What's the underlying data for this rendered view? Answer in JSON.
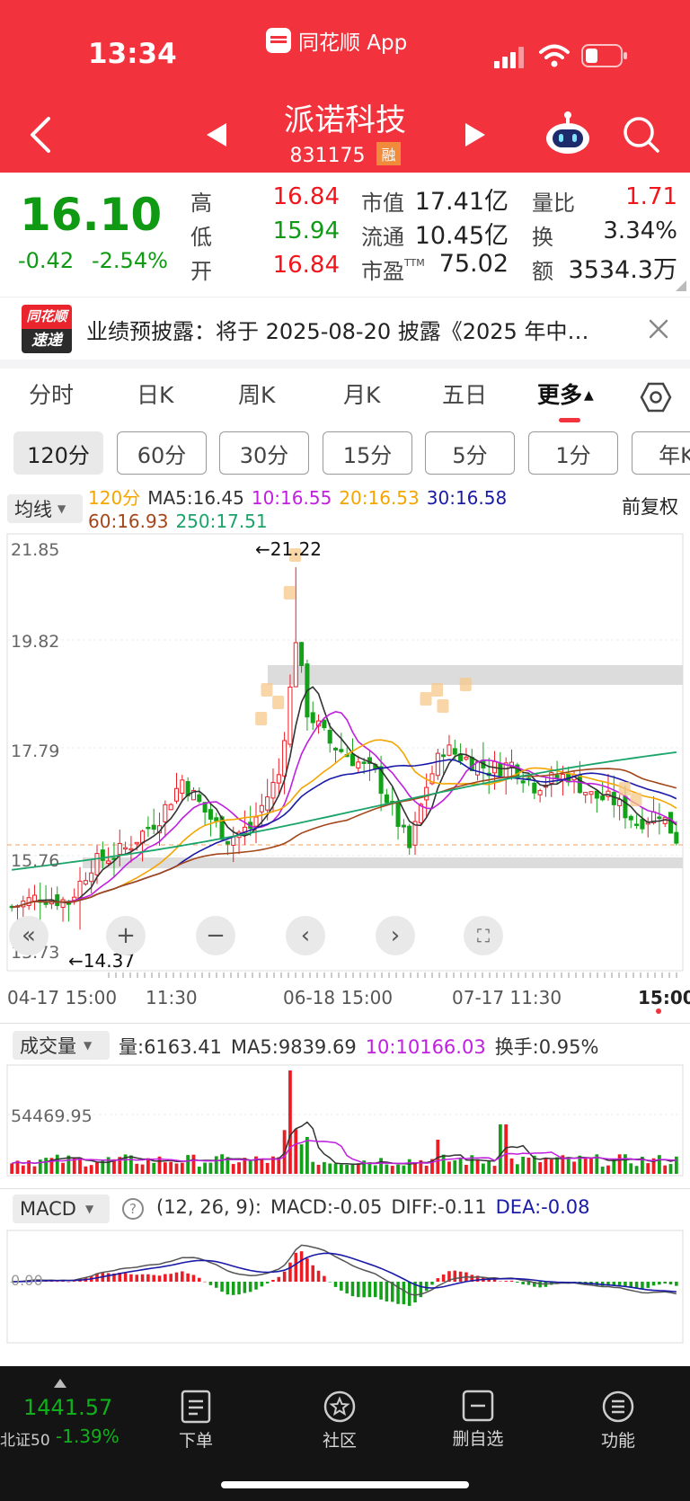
{
  "status_bar": {
    "time": "13:34",
    "app_label": "同花顺 App"
  },
  "nav": {
    "stock_name": "派诺科技",
    "stock_code": "831175",
    "badge": "融"
  },
  "quote": {
    "price": "16.10",
    "change": "-0.42",
    "change_pct": "-2.54%",
    "stats": [
      {
        "label": "高",
        "value": "16.84"
      },
      {
        "label": "低",
        "value": "15.94"
      },
      {
        "label": "开",
        "value": "16.84"
      },
      {
        "label": "市值",
        "value": "17.41亿"
      },
      {
        "label": "流通",
        "value": "10.45亿"
      },
      {
        "label": "市盈",
        "sup": "TTM",
        "value": "75.02"
      },
      {
        "label": "量比",
        "value": "1.71"
      },
      {
        "label": "换",
        "value": "3.34%"
      },
      {
        "label": "额",
        "value": "3534.3万"
      }
    ]
  },
  "bulletin": {
    "logo_top": "同花顺",
    "logo_bottom": "速递",
    "text": "业绩预披露：将于 2025-08-20 披露《2025 年中…"
  },
  "tabs": [
    {
      "label": "分时"
    },
    {
      "label": "日K"
    },
    {
      "label": "周K"
    },
    {
      "label": "月K"
    },
    {
      "label": "五日"
    },
    {
      "label": "更多"
    }
  ],
  "periods": [
    {
      "label": "120分"
    },
    {
      "label": "60分"
    },
    {
      "label": "30分"
    },
    {
      "label": "15分"
    },
    {
      "label": "5分"
    },
    {
      "label": "1分"
    },
    {
      "label": "年K"
    }
  ],
  "kline": {
    "indicator_selector": "均线",
    "period": "120分",
    "ma": [
      {
        "label": "MA5:16.45",
        "color": "#333333"
      },
      {
        "label": "10:16.55",
        "color": "#c01fe0"
      },
      {
        "label": "20:16.53",
        "color": "#f5a500"
      },
      {
        "label": "30:16.58",
        "color": "#1a1aa8"
      },
      {
        "label": "60:16.93",
        "color": "#a3461a"
      },
      {
        "label": "250:17.51",
        "color": "#1aa46a"
      }
    ],
    "adjust": "前复权",
    "price_ticks": [
      "21.85",
      "19.82",
      "17.79",
      "15.76",
      "13.73"
    ],
    "high_label": "←21.22",
    "low_label": "←14.37",
    "date_labels": [
      "04-17 15:00",
      "11:30",
      "06-18 15:00",
      "07-17 11:30",
      "15:00"
    ]
  },
  "volume": {
    "selector": "成交量",
    "vol": "量:6163.41",
    "ma5": "MA5:9839.69",
    "ma10": "10:10166.03",
    "turnover": "换手:0.95%",
    "tick": "54469.95"
  },
  "macd": {
    "selector": "MACD",
    "params": "(12, 26, 9):",
    "macd": "MACD:-0.05",
    "diff": "DIFF:-0.11",
    "dea": "DEA:-0.08",
    "zero": "0.00"
  },
  "bottom_nav": {
    "index_value": "1441.57",
    "index_name": "北证50",
    "index_change": "-1.39%",
    "items": [
      {
        "label": "下单"
      },
      {
        "label": "社区"
      },
      {
        "label": "删自选"
      },
      {
        "label": "功能"
      }
    ]
  },
  "colors": {
    "brand_red": "#f2323c",
    "up": "#f2151b",
    "down": "#109a14"
  }
}
